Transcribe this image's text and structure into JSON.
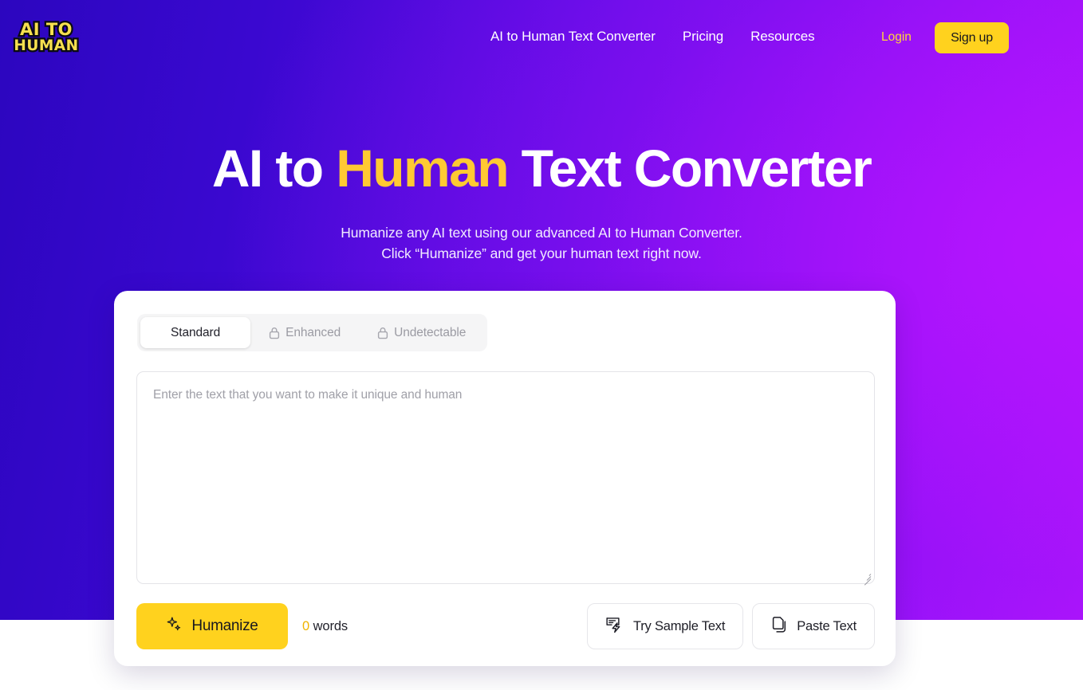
{
  "brand": {
    "logo_line1": "AI TO",
    "logo_line2": "HUMAN",
    "logo_color": "#f6e04f",
    "logo_outline": "#0b0b12"
  },
  "nav": {
    "links": [
      {
        "label": "AI to Human Text Converter"
      },
      {
        "label": "Pricing"
      },
      {
        "label": "Resources"
      }
    ],
    "login_label": "Login",
    "signup_label": "Sign up",
    "login_color": "#ffd43a",
    "signup_bg": "#ffd21e"
  },
  "hero": {
    "title_part1": "AI to ",
    "title_highlight": "Human",
    "title_part2": " Text Converter",
    "highlight_color": "#ffc933",
    "subtitle_line1": "Humanize any AI text using our advanced AI to Human Converter.",
    "subtitle_line2": "Click “Humanize” and get your human text right now.",
    "gradient_from": "#2c06bf",
    "gradient_to": "#b617ff"
  },
  "card": {
    "tabs": [
      {
        "label": "Standard",
        "active": true,
        "locked": false
      },
      {
        "label": "Enhanced",
        "active": false,
        "locked": true
      },
      {
        "label": "Undetectable",
        "active": false,
        "locked": true
      }
    ],
    "editor": {
      "placeholder": "Enter the text that you want to make it unique and human",
      "value": ""
    },
    "actions": {
      "humanize_label": "Humanize",
      "humanize_icon": "sparkles-icon",
      "humanize_bg": "#ffd21e",
      "word_count_number": "0",
      "word_count_label": "words",
      "word_count_number_color": "#f0b400",
      "sample_label": "Try Sample Text",
      "sample_icon": "sample-text-icon",
      "paste_label": "Paste Text",
      "paste_icon": "paste-icon"
    }
  }
}
